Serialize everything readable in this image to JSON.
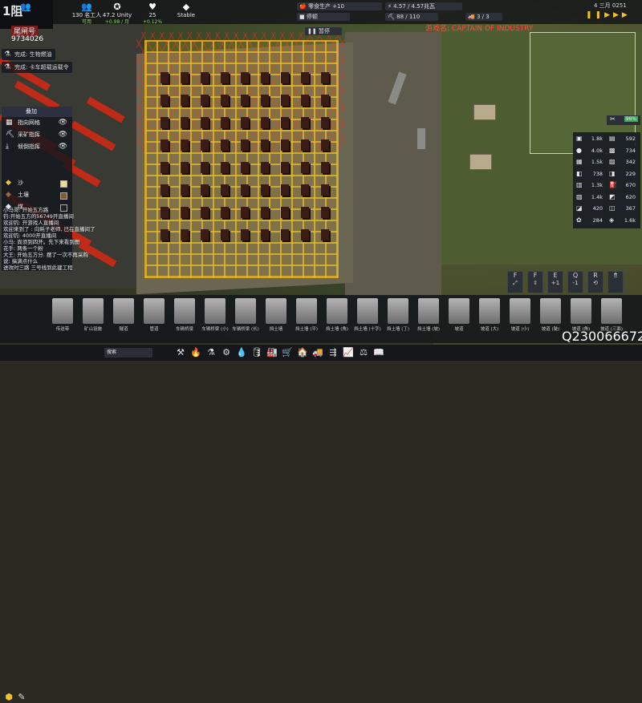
{
  "top_stats": [
    {
      "icon": "people-icon",
      "glyph": "👥",
      "value": "",
      "sub": ""
    },
    {
      "icon": "people-icon",
      "glyph": "👥",
      "value": "130 名工人",
      "sub": "可用"
    },
    {
      "icon": "unity-icon",
      "glyph": "✪",
      "value": "47.2 Unity",
      "sub": "+0.98 / 月"
    },
    {
      "icon": "health-icon",
      "glyph": "♥",
      "value": "25",
      "sub": "+0.12%"
    },
    {
      "icon": "diamond-icon",
      "glyph": "◆",
      "value": "Stable",
      "sub": ""
    }
  ],
  "food_production": "零食生产 +10",
  "stopped_label": "停顿",
  "pause_label": "暂停",
  "electricity": "4.57 / 4.57兆瓦",
  "workers_count": "88 / 110",
  "trucks_count": "3 / 3",
  "date": "4 三月 0251",
  "player": {
    "name": "尾闸号",
    "money": "9734026"
  },
  "completed": [
    "完成: 生物燃油",
    "完成: 卡车超载运载令"
  ],
  "overlay": {
    "title": "叠加",
    "items": [
      {
        "label": "指向网格",
        "icon": "grid-icon"
      },
      {
        "label": "采矿指挥",
        "icon": "pickaxe-icon"
      },
      {
        "label": "倾倒指挥",
        "icon": "dump-icon"
      }
    ],
    "items2": [
      {
        "label": "沙"
      },
      {
        "label": "土壤"
      },
      {
        "label": "煤"
      }
    ]
  },
  "chat": [
    "小马哥: 开始五方路",
    "钓:开始五方的56749开直播间",
    "欢迎钓: 开游戏人直播间",
    "欢迎来到了 : 向耗子老师, 已在直播间了",
    "欢迎钓: 4000开直播间",
    "小马: 尚须到四开。先下来看到图",
    "花手: 两条一个粉",
    "大王: 开始五方分. 摆了一次不再采购",
    "说: 搞满点什么",
    "进攻时三路 三号线到此建工程"
  ],
  "overlay_text": "游戏名: CAPTAIN OF INDUSTRY",
  "progress_percent": "96%",
  "resources": [
    {
      "icon": "box-icon",
      "glyph": "▣",
      "value": "1.8k"
    },
    {
      "icon": "wood-icon",
      "glyph": "▤",
      "value": "592"
    },
    {
      "icon": "coal-icon",
      "glyph": "●",
      "value": "4.0k"
    },
    {
      "icon": "stone-icon",
      "glyph": "▩",
      "value": "734"
    },
    {
      "icon": "iron-icon",
      "glyph": "▦",
      "value": "1.5k"
    },
    {
      "icon": "copper-icon",
      "glyph": "▨",
      "value": "342"
    },
    {
      "icon": "sand-icon",
      "glyph": "◧",
      "value": "738"
    },
    {
      "icon": "slag-icon",
      "glyph": "◨",
      "value": "229"
    },
    {
      "icon": "concrete-icon",
      "glyph": "▥",
      "value": "1.3k"
    },
    {
      "icon": "fuel-icon",
      "glyph": "⛽",
      "value": "670"
    },
    {
      "icon": "brick-icon",
      "glyph": "▧",
      "value": "1.4k"
    },
    {
      "icon": "steel-icon",
      "glyph": "◩",
      "value": "620"
    },
    {
      "icon": "glass-icon",
      "glyph": "◪",
      "value": "420"
    },
    {
      "icon": "plastic-icon",
      "glyph": "◫",
      "value": "367"
    },
    {
      "icon": "food-icon",
      "glyph": "✿",
      "value": "284"
    },
    {
      "icon": "water-icon",
      "glyph": "◈",
      "value": "1.6k"
    }
  ],
  "tool_buttons": [
    {
      "key": "F",
      "glyph": "⤢"
    },
    {
      "key": "F",
      "glyph": "⇳"
    },
    {
      "key": "E",
      "glyph": "+1"
    },
    {
      "key": "Q",
      "glyph": "-1"
    },
    {
      "key": "R",
      "glyph": "⟲"
    },
    {
      "key": "",
      "glyph": "🖱"
    }
  ],
  "toolbar": [
    {
      "label": "传送带"
    },
    {
      "label": "矿山设施"
    },
    {
      "label": "隧道"
    },
    {
      "label": "管道"
    },
    {
      "label": "车辆桥梁"
    },
    {
      "label": "车辆桥梁 (小)"
    },
    {
      "label": "车辆桥梁 (长)"
    },
    {
      "label": "挡土墙"
    },
    {
      "label": "挡土墙 (平)"
    },
    {
      "label": "挡土墙 (角)"
    },
    {
      "label": "挡土墙 (十字)"
    },
    {
      "label": "挡土墙 (丁)"
    },
    {
      "label": "挡土墙 (坡)"
    },
    {
      "label": "坡道"
    },
    {
      "label": "坡道 (大)"
    },
    {
      "label": "坡道 (小)"
    },
    {
      "label": "坡道 (陡)"
    },
    {
      "label": "坡道 (角)"
    },
    {
      "label": "坡道 (三面)"
    }
  ],
  "search_placeholder": "搜索",
  "watermark": "Q230066672",
  "bottom_icons": [
    "hammer-icon",
    "fire-icon",
    "flask-icon",
    "gear-icon",
    "drop-icon",
    "oil-icon",
    "factory-icon",
    "cart-icon",
    "house-icon",
    "truck-icon",
    "belt-icon",
    "chart-icon",
    "scale-icon",
    "book-icon"
  ]
}
